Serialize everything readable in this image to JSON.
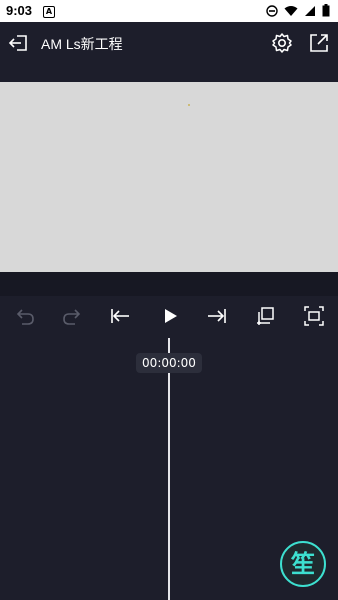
{
  "status_bar": {
    "time": "9:03",
    "app_icon_letter": "A"
  },
  "header": {
    "title": "AM Ls新工程"
  },
  "toolbar": {
    "buttons": [
      "undo",
      "redo",
      "jump-to-start",
      "play",
      "jump-to-end",
      "copy-frame",
      "crop-fit"
    ]
  },
  "timeline": {
    "current_time": "00:00:00"
  },
  "watermark": {
    "char": "笙"
  },
  "colors": {
    "background": "#1d1e2b",
    "preview": "#d8d8d8",
    "accent": "#3de0d0"
  }
}
